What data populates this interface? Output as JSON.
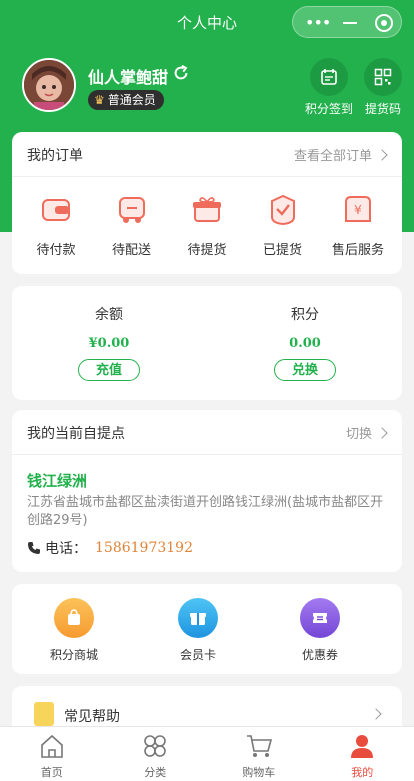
{
  "header": {
    "title": "个人中心"
  },
  "user": {
    "nickname": "仙人掌鲍甜",
    "level": "普通会员"
  },
  "quick_actions": [
    {
      "label": "积分签到",
      "icon": "calendar-icon"
    },
    {
      "label": "提货码",
      "icon": "qrcode-icon"
    }
  ],
  "orders": {
    "title": "我的订单",
    "view_all": "查看全部订单",
    "items": [
      {
        "label": "待付款",
        "icon": "wallet-icon"
      },
      {
        "label": "待配送",
        "icon": "delivery-truck-icon"
      },
      {
        "label": "待提货",
        "icon": "gift-box-icon"
      },
      {
        "label": "已提货",
        "icon": "checked-box-icon"
      },
      {
        "label": "售后服务",
        "icon": "refund-icon"
      }
    ]
  },
  "balance": {
    "balance_label": "余额",
    "balance_value": "¥0.00",
    "recharge_label": "充值",
    "points_label": "积分",
    "points_value": "0.00",
    "exchange_label": "兑换"
  },
  "pickup": {
    "title": "我的当前自提点",
    "switch_label": "切换",
    "name": "钱江绿洲",
    "address": "江苏省盐城市盐都区盐渎街道开创路钱江绿洲(盐城市盐都区开创路29号)",
    "phone_label": "电话：",
    "phone": "15861973192"
  },
  "services": [
    {
      "label": "积分商城",
      "icon": "shopping-bag-icon",
      "color": "#f7a23a"
    },
    {
      "label": "会员卡",
      "icon": "gift-card-icon",
      "color": "#2fa6ea"
    },
    {
      "label": "优惠券",
      "icon": "coupon-icon",
      "color": "#8a5ae0"
    }
  ],
  "help": {
    "label": "常见帮助"
  },
  "tabbar": [
    {
      "label": "首页",
      "icon": "home-icon"
    },
    {
      "label": "分类",
      "icon": "category-icon"
    },
    {
      "label": "购物车",
      "icon": "cart-icon"
    },
    {
      "label": "我的",
      "icon": "user-icon",
      "active": true
    }
  ],
  "colors": {
    "brand": "#22b14c",
    "accent": "#e84c3d",
    "phone": "#e0843a"
  }
}
